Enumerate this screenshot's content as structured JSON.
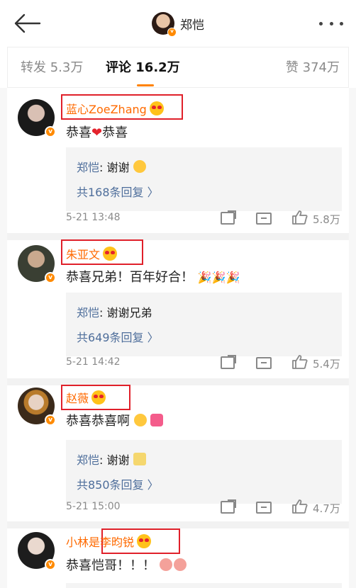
{
  "header": {
    "title": "郑恺"
  },
  "tabs": [
    {
      "label": "转发 5.3万"
    },
    {
      "label": "评论 16.2万"
    },
    {
      "label": "赞 374万"
    }
  ],
  "comments": [
    {
      "name": "蓝心ZoeZhang",
      "text_before": "恭喜",
      "text_heart": "❤",
      "text_after": "恭喜",
      "reply_author": "郑恺",
      "reply_sep": ": ",
      "reply_text": "谢谢",
      "reply_count": "共168条回复 〉",
      "time": "5-21 13:48",
      "likes": "5.8万"
    },
    {
      "name": "朱亚文",
      "text": "恭喜兄弟！百年好合！",
      "reply_author": "郑恺",
      "reply_sep": ": ",
      "reply_text": "谢谢兄弟",
      "reply_count": "共649条回复 〉",
      "time": "5-21 14:42",
      "likes": "5.4万"
    },
    {
      "name": "赵薇",
      "text": "恭喜恭喜啊",
      "reply_author": "郑恺",
      "reply_sep": ": ",
      "reply_text": "谢谢",
      "reply_count": "共850条回复 〉",
      "time": "5-21 15:00",
      "likes": "4.7万"
    },
    {
      "name": "小林是李昀锐",
      "text": "恭喜恺哥！！！"
    }
  ],
  "icons": {
    "verified_badge": "v",
    "party": "🎉"
  }
}
